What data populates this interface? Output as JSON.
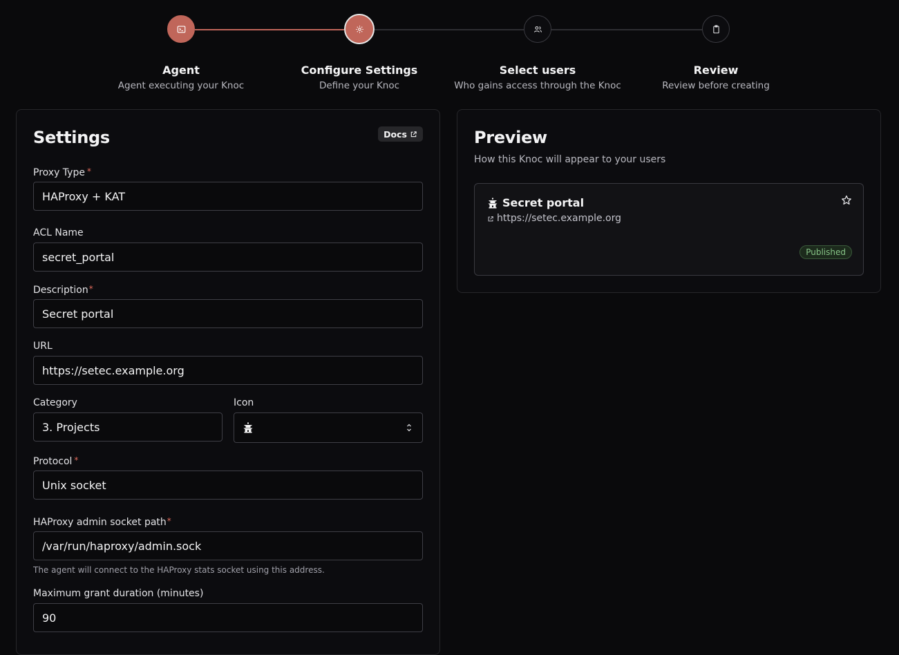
{
  "stepper": {
    "steps": [
      {
        "title": "Agent",
        "subtitle": "Agent executing your Knoc",
        "icon": "terminal-icon",
        "state": "done"
      },
      {
        "title": "Configure Settings",
        "subtitle": "Define your Knoc",
        "icon": "gear-icon",
        "state": "current"
      },
      {
        "title": "Select users",
        "subtitle": "Who gains access through the Knoc",
        "icon": "users-icon",
        "state": "pending"
      },
      {
        "title": "Review",
        "subtitle": "Review before creating",
        "icon": "clipboard-icon",
        "state": "pending"
      }
    ]
  },
  "settings": {
    "title": "Settings",
    "docs_label": "Docs",
    "proxy_type": {
      "label": "Proxy Type",
      "required_mark": "*",
      "value": "HAProxy + KAT"
    },
    "acl_name": {
      "label": "ACL Name",
      "value": "secret_portal"
    },
    "description": {
      "label": "Description",
      "required_mark": "*",
      "value": "Secret portal"
    },
    "url": {
      "label": "URL",
      "value": "https://setec.example.org"
    },
    "category": {
      "label": "Category",
      "value": "3. Projects"
    },
    "icon": {
      "label": "Icon",
      "value": "pagoda-icon"
    },
    "protocol": {
      "label": "Protocol",
      "required_mark": "*",
      "value": "Unix socket"
    },
    "socket_path": {
      "label": "HAProxy admin socket path",
      "required_mark": "*",
      "value": "/var/run/haproxy/admin.sock",
      "hint": "The agent will connect to the HAProxy stats socket using this address."
    },
    "max_grant": {
      "label": "Maximum grant duration (minutes)",
      "value": "90"
    }
  },
  "preview": {
    "title": "Preview",
    "subtitle": "How this Knoc will appear to your users",
    "card": {
      "title": "Secret portal",
      "url": "https://setec.example.org",
      "badge": "Published"
    }
  },
  "colors": {
    "accent": "#c0665a",
    "background": "#0a0a0c",
    "border": "#27272a"
  }
}
